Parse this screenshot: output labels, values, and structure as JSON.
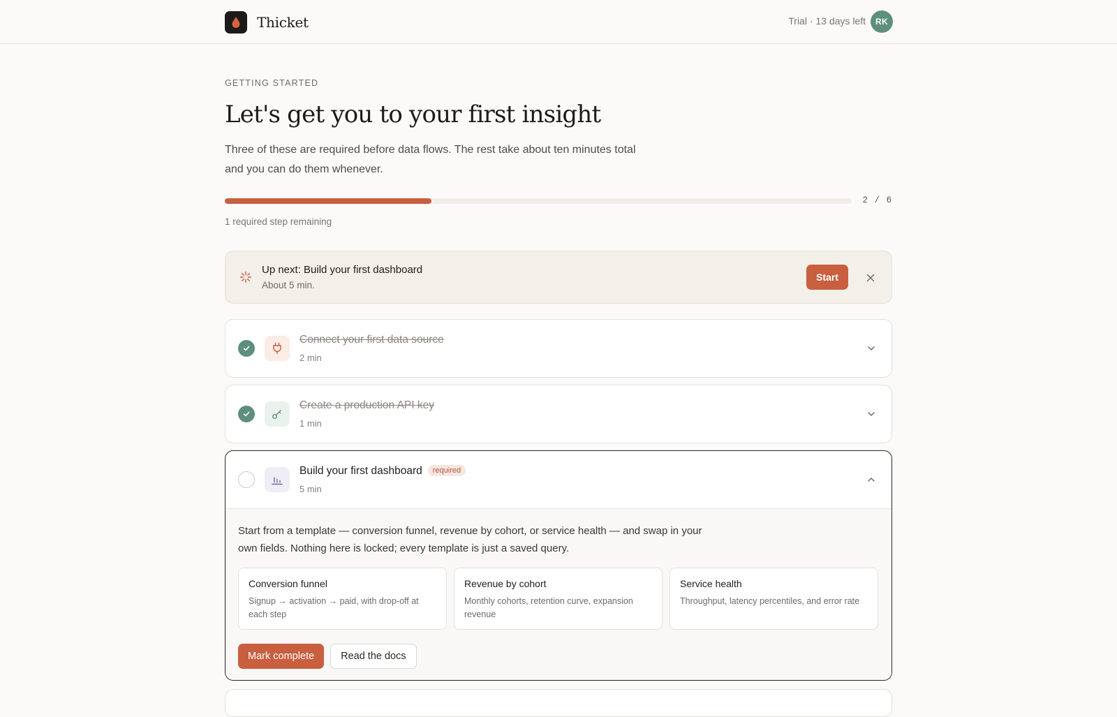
{
  "app": {
    "name": "Thicket",
    "trial_text": "Trial · 13 days left",
    "user_initials": "RK"
  },
  "page": {
    "eyebrow": "GETTING STARTED",
    "title": "Let's get you to your first insight",
    "subtitle": "Three of these are required before data flows. The rest take about ten minutes total and you can do them whenever."
  },
  "progress": {
    "completed": 2,
    "total": 6,
    "count_text": "2 / 6",
    "fill_percent": 33,
    "remaining_text": "1 required step remaining"
  },
  "up_next": {
    "title": "Up next: Build your first dashboard",
    "subtitle": "About 5 min.",
    "start_label": "Start"
  },
  "steps": [
    {
      "title": "Connect your first data source",
      "time": "2 min",
      "status": "done",
      "icon": "plug-icon"
    },
    {
      "title": "Create a production API key",
      "time": "1 min",
      "status": "done",
      "icon": "key-icon"
    },
    {
      "title": "Build your first dashboard",
      "badge": "required",
      "time": "5 min",
      "status": "active",
      "icon": "bar-chart-icon",
      "description": "Start from a template — conversion funnel, revenue by cohort, or service health — and swap in your own fields. Nothing here is locked; every template is just a saved query.",
      "templates": [
        {
          "name": "Conversion funnel",
          "desc": "Signup → activation → paid, with drop-off at each step"
        },
        {
          "name": "Revenue by cohort",
          "desc": "Monthly cohorts, retention curve, expansion revenue"
        },
        {
          "name": "Service health",
          "desc": "Throughput, latency percentiles, and error rate"
        }
      ],
      "primary_label": "Mark complete",
      "secondary_label": "Read the docs"
    }
  ],
  "colors": {
    "accent": "#c85f3f",
    "success": "#5e8f7c",
    "background": "#fbfaf8"
  }
}
